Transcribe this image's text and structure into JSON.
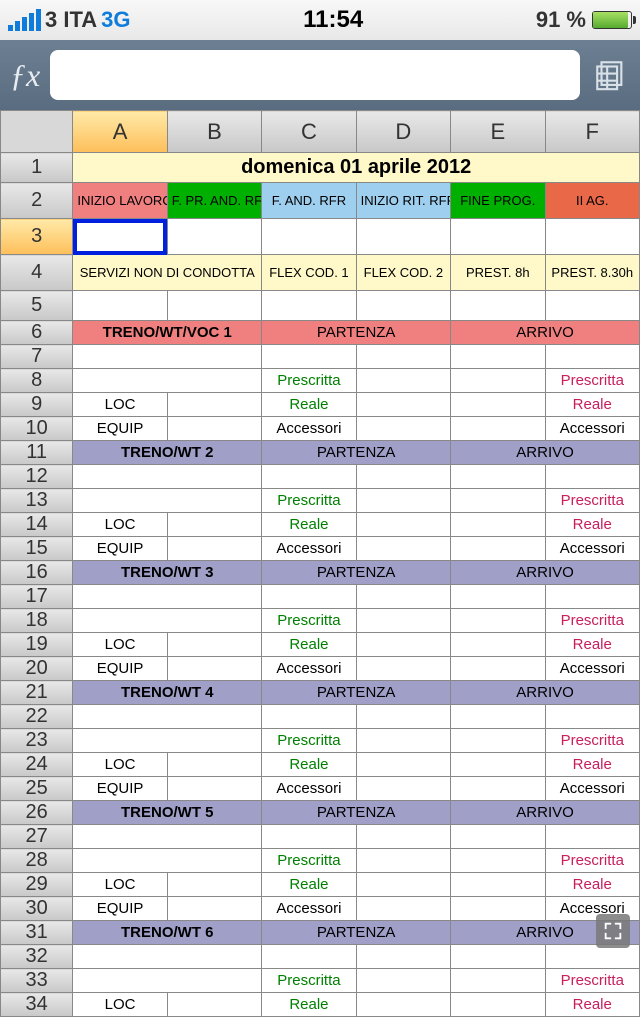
{
  "status": {
    "carrier": "3 ITA",
    "network": "3G",
    "time": "11:54",
    "battery_pct": "91 %"
  },
  "formula": {
    "fx": "ƒx",
    "value": ""
  },
  "cols": [
    "A",
    "B",
    "C",
    "D",
    "E",
    "F"
  ],
  "title": "domenica 01 aprile 2012",
  "hdr2": {
    "a": "INIZIO LAVORO",
    "b": "F. PR. AND. RFR",
    "c": "F. AND. RFR",
    "d": "INIZIO RIT. RFR",
    "e": "FINE PROG.",
    "f": "II AG."
  },
  "hdr4": {
    "ab": "SERVIZI NON DI CONDOTTA",
    "c": "FLEX COD. 1",
    "d": "FLEX COD. 2",
    "e": "PREST. 8h",
    "f": "PREST. 8.30h"
  },
  "labels": {
    "partenza": "PARTENZA",
    "arrivo": "ARRIVO",
    "prescritta": "Prescritta",
    "reale": "Reale",
    "accessori": "Accessori",
    "loc": "LOC",
    "equip": "EQUIP"
  },
  "blocks": [
    {
      "title": "TRENO/WT/VOC 1",
      "bg": "bg-red"
    },
    {
      "title": "TRENO/WT 2",
      "bg": "bg-purple"
    },
    {
      "title": "TRENO/WT 3",
      "bg": "bg-purple"
    },
    {
      "title": "TRENO/WT 4",
      "bg": "bg-purple"
    },
    {
      "title": "TRENO/WT 5",
      "bg": "bg-purple"
    },
    {
      "title": "TRENO/WT 6",
      "bg": "bg-purple"
    }
  ]
}
